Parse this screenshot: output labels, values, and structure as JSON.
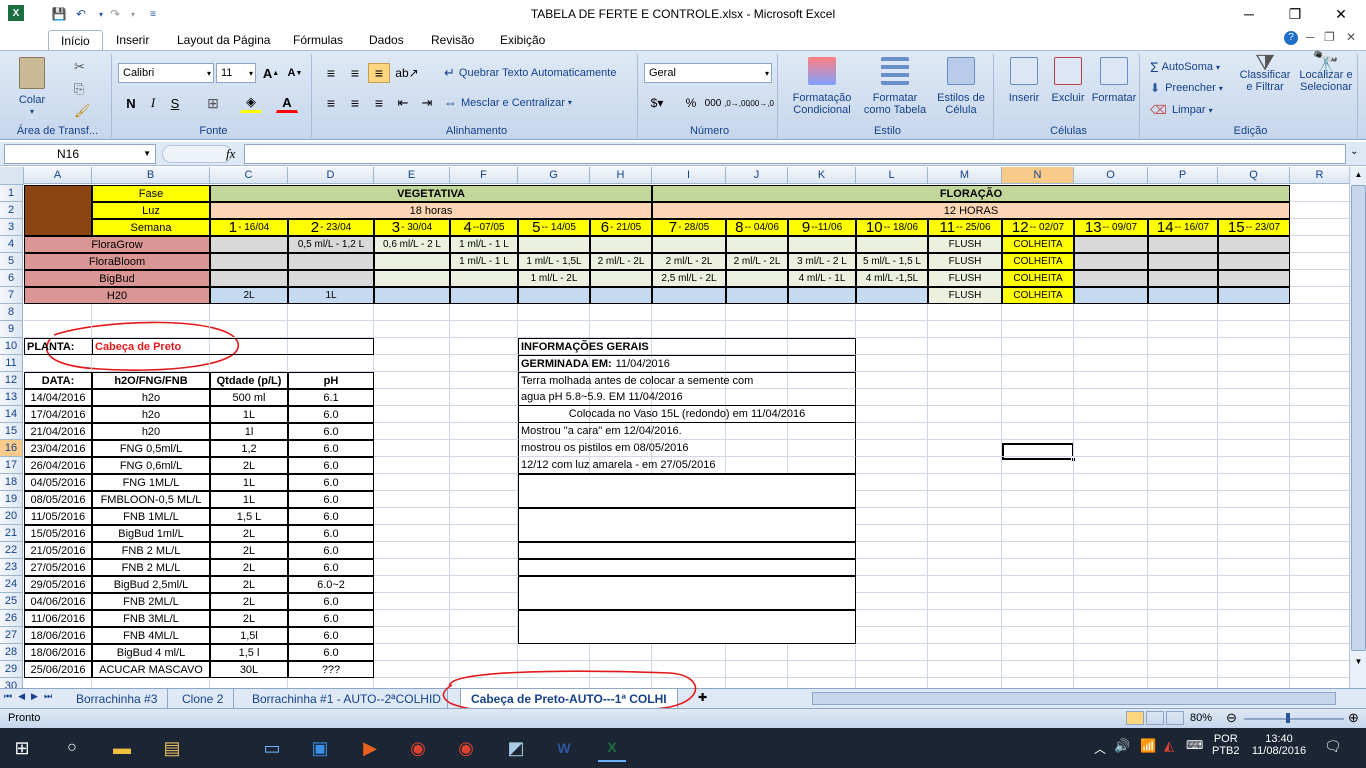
{
  "window": {
    "title": "TABELA DE FERTE E CONTROLE.xlsx - Microsoft Excel"
  },
  "ribbon_tabs": [
    "Início",
    "Inserir",
    "Layout da Página",
    "Fórmulas",
    "Dados",
    "Revisão",
    "Exibição"
  ],
  "ribbon": {
    "paste": "Colar",
    "clipboard_group": "Área de Transf...",
    "font_name": "Calibri",
    "font_size": "11",
    "font_group": "Fonte",
    "wrap_text": "Quebrar Texto Automaticamente",
    "merge_center": "Mesclar e Centralizar",
    "alignment_group": "Alinhamento",
    "number_format": "Geral",
    "number_group": "Número",
    "cond_format": "Formatação Condicional",
    "format_table": "Formatar como Tabela",
    "cell_styles": "Estilos de Célula",
    "styles_group": "Estilo",
    "insert": "Inserir",
    "delete": "Excluir",
    "format": "Formatar",
    "cells_group": "Células",
    "autosum": "AutoSoma",
    "fill": "Preencher",
    "clear": "Limpar",
    "sort_filter": "Classificar e Filtrar",
    "find_select": "Localizar e Selecionar",
    "editing_group": "Edição"
  },
  "formula_bar": {
    "name_box": "N16",
    "fx": "fx",
    "formula": ""
  },
  "columns": [
    "A",
    "B",
    "C",
    "D",
    "E",
    "F",
    "G",
    "H",
    "I",
    "J",
    "K",
    "L",
    "M",
    "N",
    "O",
    "P",
    "Q",
    "R"
  ],
  "rows": [
    "1",
    "2",
    "3",
    "4",
    "5",
    "6",
    "7",
    "8",
    "9",
    "10",
    "11",
    "12",
    "13",
    "14",
    "15",
    "16",
    "17",
    "18",
    "19",
    "20",
    "21",
    "22",
    "23",
    "24",
    "25",
    "26",
    "27",
    "28",
    "29",
    "30"
  ],
  "schedule": {
    "fase_label": "Fase",
    "luz_label": "Luz",
    "semana_label": "Semana",
    "vegetativa": "VEGETATIVA",
    "floracao": "FLORAÇÃO",
    "luz_veg": "18 horas",
    "luz_flor": "12 HORAS",
    "weeks": [
      {
        "n": "1",
        "d": " - 16/04"
      },
      {
        "n": "2",
        "d": " - 23/04"
      },
      {
        "n": "3",
        "d": " - 30/04"
      },
      {
        "n": "4",
        "d": " --07/05"
      },
      {
        "n": "5",
        "d": " -- 14/05"
      },
      {
        "n": "6",
        "d": " - 21/05"
      },
      {
        "n": "7",
        "d": " - 28/05"
      },
      {
        "n": "8",
        "d": " -- 04/06"
      },
      {
        "n": "9",
        "d": "--11/06"
      },
      {
        "n": "10",
        "d": " -- 18/06"
      },
      {
        "n": "11",
        "d": " -- 25/06"
      },
      {
        "n": "12",
        "d": " -- 02/07"
      },
      {
        "n": "13",
        "d": " -- 09/07"
      },
      {
        "n": "14",
        "d": " -- 16/07"
      },
      {
        "n": "15",
        "d": " -- 23/07"
      }
    ],
    "products": [
      {
        "name": "FloraGrow",
        "values": [
          "",
          "0,5 ml/L - 1,2 L",
          "0,6 ml/L - 2 L",
          "1 ml/L - 1 L",
          "",
          "",
          "",
          "",
          "",
          "",
          "FLUSH",
          "COLHEITA",
          "",
          "",
          ""
        ]
      },
      {
        "name": "FloraBloom",
        "values": [
          "",
          "",
          "",
          "1 ml/L - 1 L",
          "1 ml/L - 1,5L",
          "2 ml/L - 2L",
          "2 ml/L - 2L",
          "2 ml/L - 2L",
          "3 ml/L - 2 L",
          "5 ml/L - 1,5 L",
          "FLUSH",
          "COLHEITA",
          "",
          "",
          ""
        ]
      },
      {
        "name": "BigBud",
        "values": [
          "",
          "",
          "",
          "",
          "1 ml/L - 2L",
          "",
          "2,5 ml/L - 2L",
          "",
          "4 ml/L - 1L",
          "4 ml/L -1,5L",
          "FLUSH",
          "COLHEITA",
          "",
          "",
          ""
        ]
      },
      {
        "name": "H20",
        "values": [
          "2L",
          "1L",
          "",
          "",
          "",
          "",
          "",
          "",
          "",
          "",
          "FLUSH",
          "COLHEITA",
          "",
          "",
          ""
        ]
      }
    ]
  },
  "plant": {
    "label": "PLANTA:",
    "name": "Cabeça de Preto"
  },
  "log": {
    "headers": [
      "DATA:",
      "h2O/FNG/FNB",
      "Qtdade (p/L)",
      "pH"
    ],
    "rows": [
      [
        "14/04/2016",
        "h2o",
        "500 ml",
        "6.1"
      ],
      [
        "17/04/2016",
        "h2o",
        "1L",
        "6.0"
      ],
      [
        "21/04/2016",
        "h20",
        "1l",
        "6.0"
      ],
      [
        "23/04/2016",
        "FNG 0,5ml/L",
        "1,2",
        "6.0"
      ],
      [
        "26/04/2016",
        "FNG 0,6ml/L",
        "2L",
        "6.0"
      ],
      [
        "04/05/2016",
        "FNG 1ML/L",
        "1L",
        "6.0"
      ],
      [
        "08/05/2016",
        "FMBLOON-0,5 ML/L",
        "1L",
        "6.0"
      ],
      [
        "11/05/2016",
        "FNB 1ML/L",
        "1,5 L",
        "6.0"
      ],
      [
        "15/05/2016",
        "BigBud 1ml/L",
        "2L",
        "6.0"
      ],
      [
        "21/05/2016",
        "FNB 2 ML/L",
        "2L",
        "6.0"
      ],
      [
        "27/05/2016",
        "FNB 2 ML/L",
        "2L",
        "6.0"
      ],
      [
        "29/05/2016",
        "BigBud 2,5ml/L",
        "2L",
        "6.0~2"
      ],
      [
        "04/06/2016",
        "FNB 2ML/L",
        "2L",
        "6.0"
      ],
      [
        "11/06/2016",
        "FNB 3ML/L",
        "2L",
        "6.0"
      ],
      [
        "18/06/2016",
        "FNB 4ML/L",
        "1,5l",
        "6.0"
      ],
      [
        "18/06/2016",
        "BigBud 4 ml/L",
        "1,5 l",
        "6.0"
      ],
      [
        "25/06/2016",
        "ACUCAR MASCAVO",
        "30L",
        "???"
      ]
    ]
  },
  "info": {
    "title": "INFORMAÇÕES GERAIS",
    "germinada_label": "GERMINADA EM:",
    "germinada_date": "11/04/2016",
    "lines": [
      "Terra molhada antes de colocar a semente com",
      "agua pH 5.8~5.9. EM 11/04/2016",
      "Colocada no Vaso 15L (redondo) em 11/04/2016",
      "Mostrou \"a cara\" em 12/04/2016.",
      "mostrou os pistilos em 08/05/2016",
      "12/12 com luz amarela - em 27/05/2016"
    ]
  },
  "sheet_tabs": [
    "Borrachinha #3",
    "Clone 2",
    "Borrachinha #1 - AUTO--2ªCOLHID",
    "Cabeça de Preto-AUTO---1ª COLHI"
  ],
  "status": {
    "ready": "Pronto",
    "zoom": "80%"
  },
  "taskbar": {
    "lang": "POR",
    "layout": "PTB2",
    "time": "13:40",
    "date": "11/08/2016"
  },
  "colors": {
    "fase_yellow": "#ffff00",
    "veg_green": "#c4d79b",
    "luz_peach": "#fcd5b4",
    "product_red": "#da9694",
    "weeks_gray": "#d9d9d9",
    "n_col_selected": "#f8cb8b",
    "annotation_red": "#e31a1c"
  }
}
